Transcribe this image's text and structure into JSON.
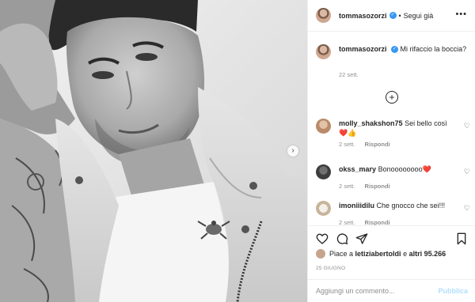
{
  "photo": {
    "next_icon": "chevron-right-icon",
    "description_icon": "photo"
  },
  "header": {
    "username": "tommasozorzi",
    "verified_icon": "verified-badge-icon",
    "separator": "•",
    "follow_label": "Segui già",
    "more_icon": "more-horizontal-icon"
  },
  "caption": {
    "username": "tommasozorzi",
    "text": "Mi rifaccio la boccia?",
    "time": "22 sett."
  },
  "load_more_icon": "plus-circle-icon",
  "comments": [
    {
      "username": "molly_shakshon75",
      "text": "Sei bello così ❤️👍",
      "time": "2 sett.",
      "reply": "Rispondi"
    },
    {
      "username": "okss_mary",
      "text": "Bonoooooooo❤️",
      "time": "2 sett.",
      "reply": "Rispondi"
    },
    {
      "username": "imoniiidilu",
      "text": "Che gnocco che sei!!!",
      "time": "2 sett.",
      "reply": "Rispondi"
    }
  ],
  "actions": {
    "like_icon": "heart-icon",
    "comment_icon": "comment-icon",
    "share_icon": "paper-plane-icon",
    "save_icon": "bookmark-icon"
  },
  "likes": {
    "prefix": "Piace a",
    "user": "letiziabertoldi",
    "middle": "e",
    "others": "altri 95.266"
  },
  "post_date": "25 GIUGNO",
  "add_comment": {
    "placeholder": "Aggiungi un commento...",
    "publish_label": "Pubblica"
  },
  "colors": {
    "accent": "#3897f0",
    "publish_disabled": "#b2dffc",
    "meta_gray": "#8e8e8e",
    "text": "#262626"
  }
}
